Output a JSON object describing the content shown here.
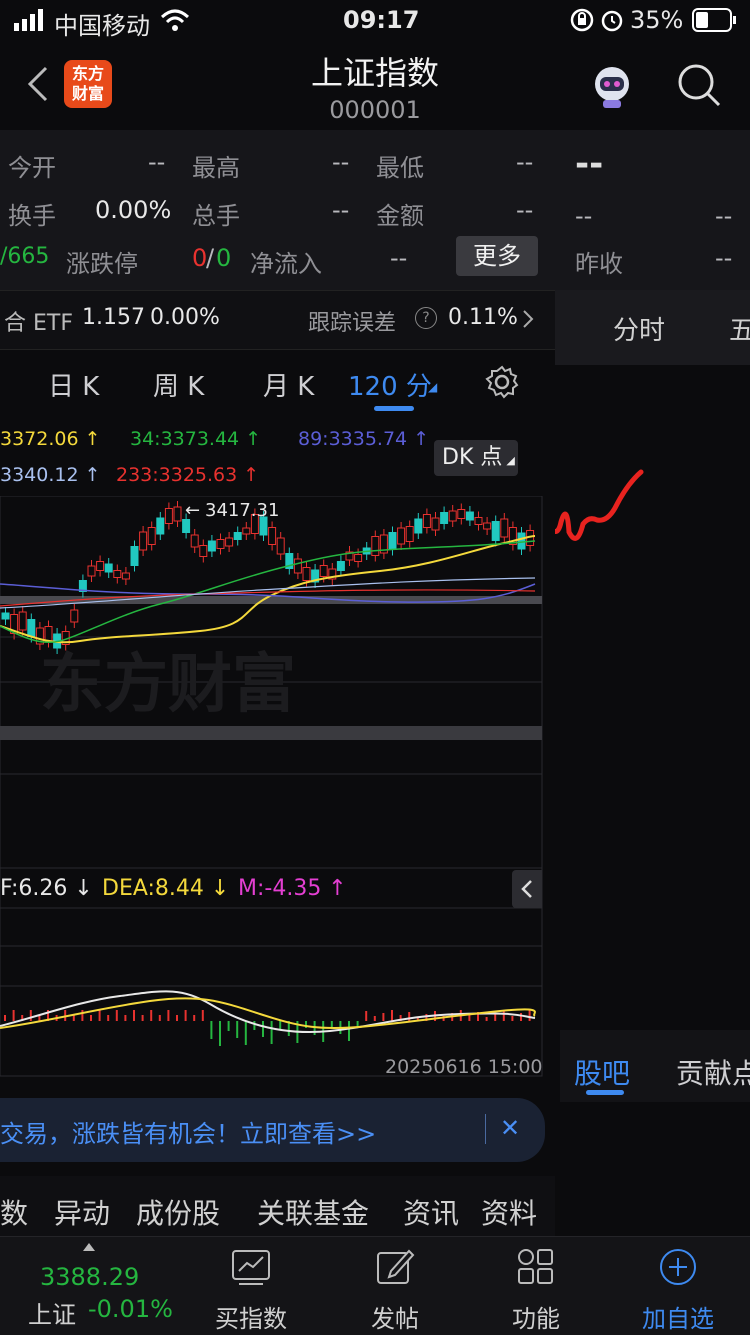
{
  "status": {
    "carrier": "中国移动",
    "time": "09:17",
    "battery": "35%"
  },
  "nav": {
    "title": "上证指数",
    "code": "000001",
    "logo_line1": "东方",
    "logo_line2": "财富"
  },
  "quote": {
    "open_label": "今开",
    "open_value": "--",
    "high_label": "最高",
    "high_value": "--",
    "low_label": "最低",
    "low_value": "--",
    "turnover_label": "换手",
    "turnover_value": "0.00%",
    "volume_label": "总手",
    "volume_value": "--",
    "amount_label": "金额",
    "amount_value": "--",
    "partial_ratio": "/665",
    "limit_label": "涨跌停",
    "limit_up": "0",
    "limit_sep": "/",
    "limit_down": "0",
    "netflow_label": "净流入",
    "netflow_value": "--",
    "more_button": "更多"
  },
  "quote_right": {
    "big_value": "--",
    "left_value": "--",
    "right_value": "--",
    "prev_close_label": "昨收",
    "prev_close_value": "--"
  },
  "etf": {
    "name": "合 ETF",
    "price": "1.157",
    "change": "0.00%",
    "track_label": "跟踪误差",
    "help": "?",
    "track_value": "0.11%"
  },
  "right_tabs": {
    "tab1": "分时",
    "tab2": "五"
  },
  "ktabs": {
    "day": "日 K",
    "week": "周 K",
    "month": "月 K",
    "active": "120 分"
  },
  "ma": {
    "ma5": "3372.06 ↑",
    "ma34": "34:3373.44 ↑",
    "ma89": "89:3335.74 ↑",
    "ma_b": "3340.12 ↑",
    "ma233": "233:3325.63 ↑",
    "dk_button": "DK 点",
    "high_marker": "3417.31",
    "watermark": "东方财富"
  },
  "macd": {
    "dif": "F:6.26 ↓",
    "dea": "DEA:8.44 ↓",
    "m": "M:-4.35 ↑",
    "timestamp": "20250616 15:00"
  },
  "banner": {
    "text": "交易，涨跌皆有机会！立即查看>>",
    "close": "✕"
  },
  "sub_tabs": [
    "数",
    "异动",
    "成份股",
    "关联基金",
    "资讯",
    "资料"
  ],
  "right_bottom_tabs": {
    "tab1": "股吧",
    "tab2": "贡献点"
  },
  "tabbar": {
    "index_value": "3388.29",
    "index_name": "上证",
    "index_change": "-0.01%",
    "buy": "买指数",
    "post": "发帖",
    "func": "功能",
    "add": "加自选"
  },
  "colors": {
    "up": "#e8322f",
    "down": "#21c8c0",
    "green": "#25b640",
    "yellow": "#f4d93c",
    "purple": "#5b5ed6",
    "blue": "#3e8af0"
  },
  "chart_data": {
    "type": "line",
    "title": "",
    "series": [
      {
        "name": "MA5",
        "values": [
          3372.06
        ]
      },
      {
        "name": "MA34",
        "values": [
          3373.44
        ]
      },
      {
        "name": "MA89",
        "values": [
          3335.74
        ]
      },
      {
        "name": "MA233",
        "values": [
          3325.63
        ]
      }
    ],
    "annotations": [
      "3417.31"
    ]
  }
}
